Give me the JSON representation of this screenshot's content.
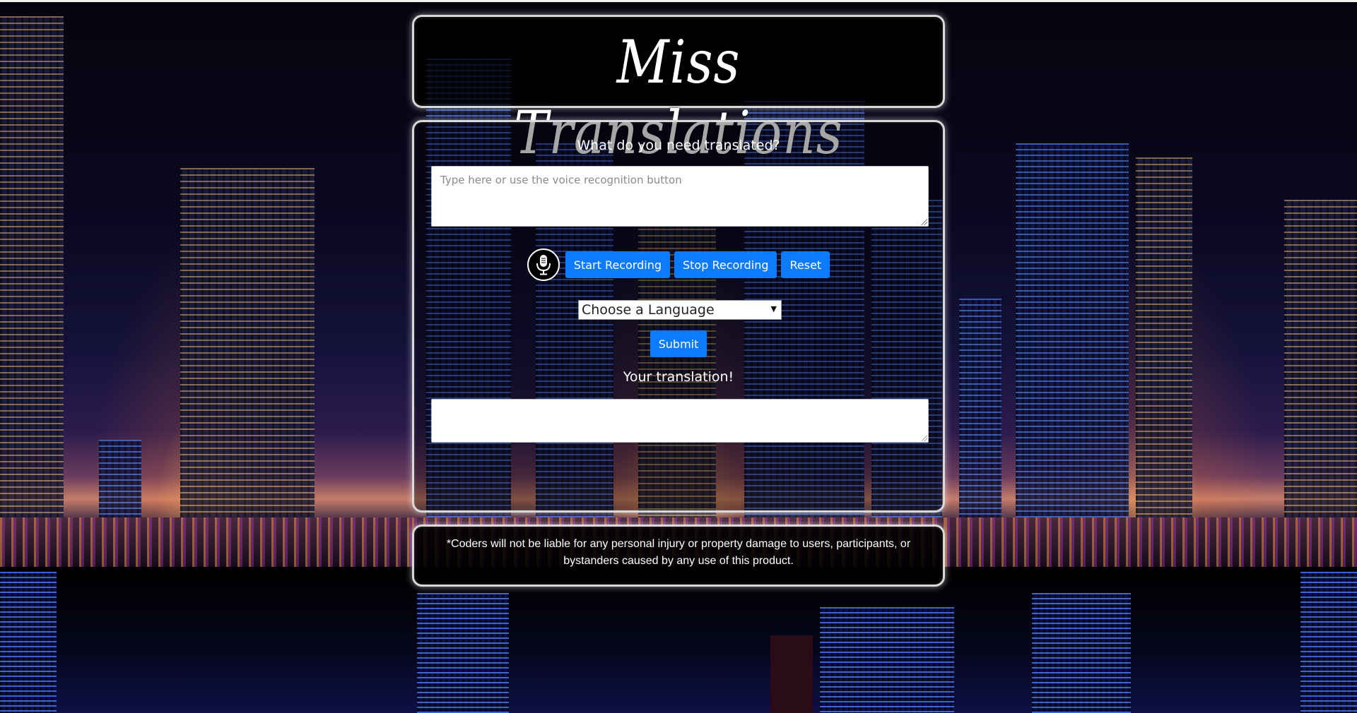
{
  "header": {
    "title": "Miss Translations"
  },
  "main": {
    "prompt": "What do you need translated?",
    "input": {
      "placeholder": "Type here or use the voice recognition button",
      "value": ""
    },
    "controls": {
      "mic_icon": "microphone-icon",
      "start_label": "Start Recording",
      "stop_label": "Stop Recording",
      "reset_label": "Reset"
    },
    "language_select": {
      "selected": "Choose a Language"
    },
    "submit_label": "Submit",
    "result_label": "Your translation!",
    "output": {
      "value": ""
    }
  },
  "footer": {
    "disclaimer": "*Coders will not be liable for any personal injury or property damage to users, participants, or bystanders caused by any use of this product."
  },
  "colors": {
    "button": "#0d7bff",
    "panel_border": "#d9d9d9"
  }
}
